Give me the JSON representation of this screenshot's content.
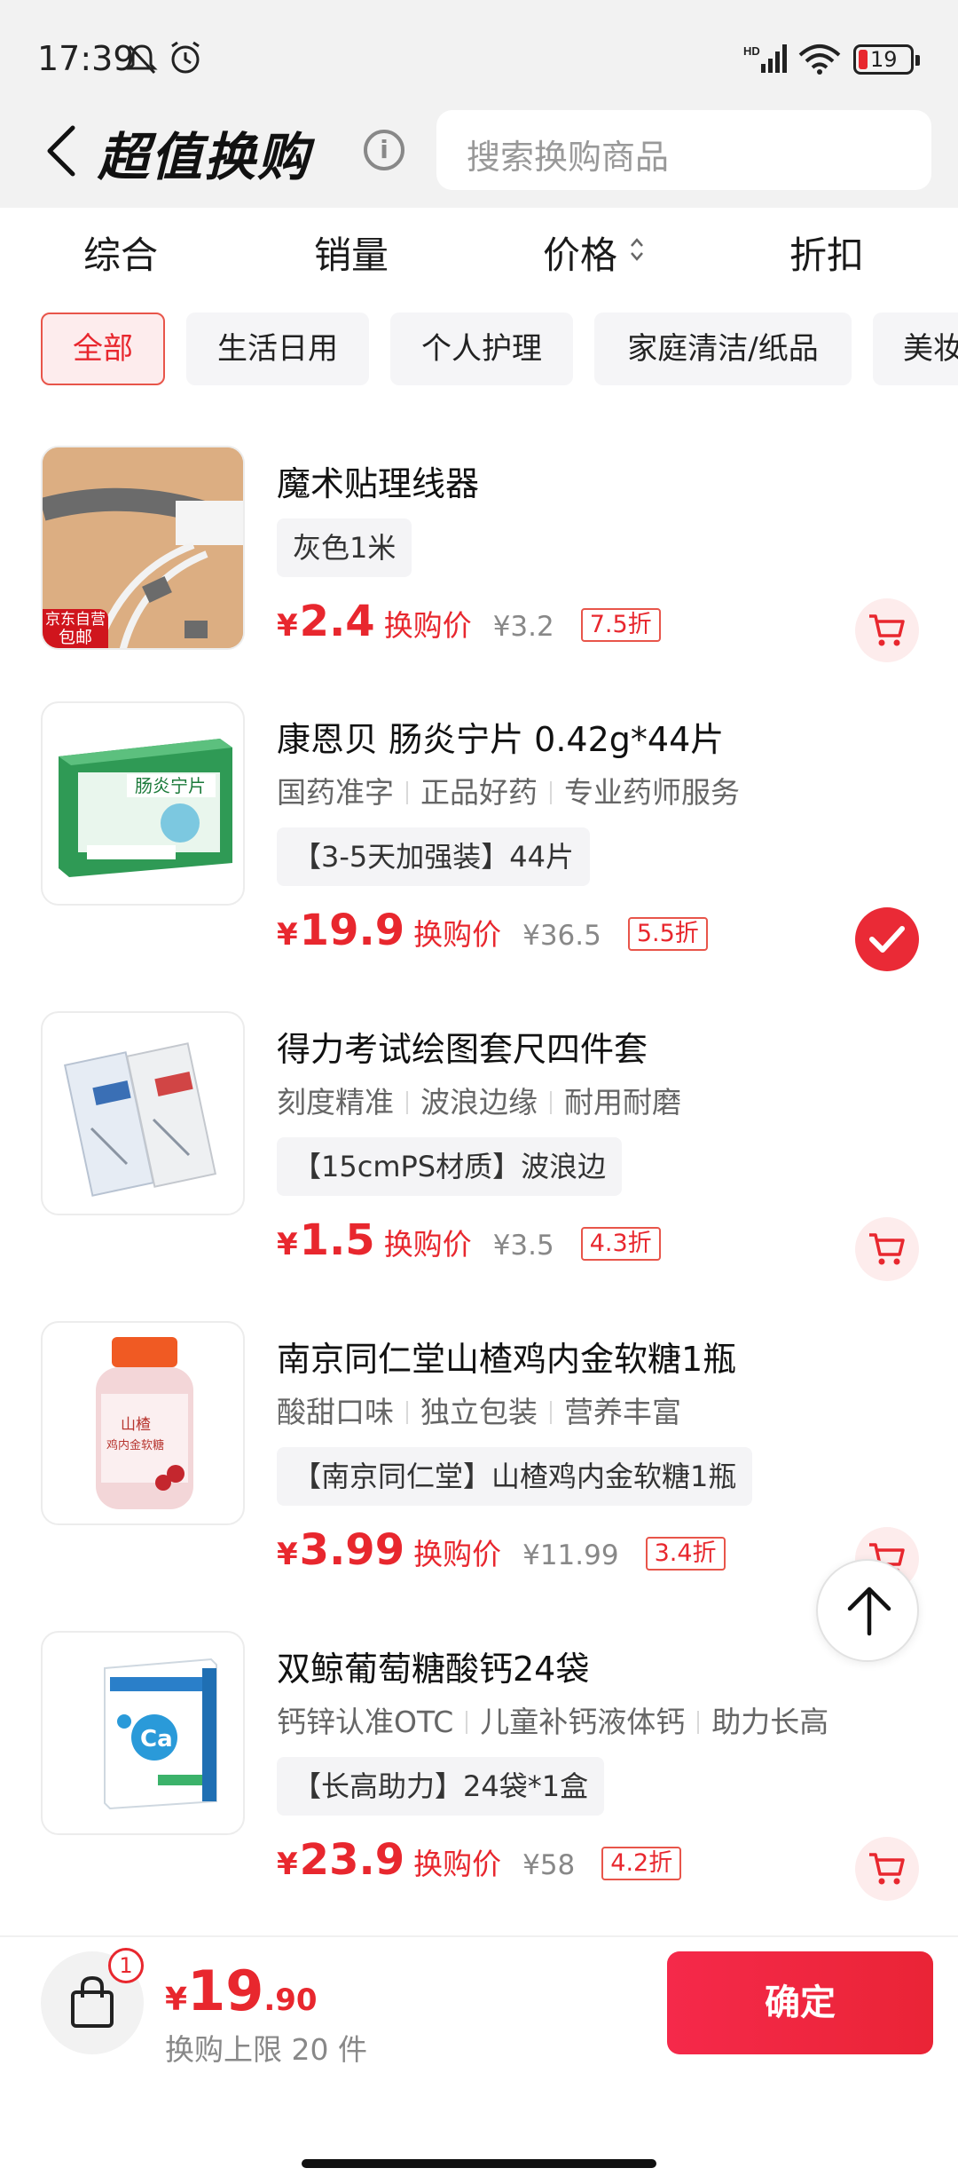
{
  "status_bar": {
    "time": "17:39",
    "battery": "19"
  },
  "header": {
    "title": "超值换购",
    "search_placeholder": "搜索换购商品"
  },
  "sort_tabs": [
    {
      "label": "综合"
    },
    {
      "label": "销量"
    },
    {
      "label": "价格"
    },
    {
      "label": "折扣"
    }
  ],
  "categories": [
    {
      "label": "全部",
      "active": true
    },
    {
      "label": "生活日用"
    },
    {
      "label": "个人护理"
    },
    {
      "label": "家庭清洁/纸品"
    },
    {
      "label": "美妆"
    }
  ],
  "items": [
    {
      "name": "魔术贴理线器",
      "tags": [],
      "spec": "灰色1米",
      "price": "2.4",
      "price_label": "换购价",
      "orig_price": "¥3.2",
      "discount": "7.5折",
      "badge": [
        "京东自营",
        "包邮"
      ],
      "selected": false,
      "icon": "cart-icon"
    },
    {
      "name": "康恩贝 肠炎宁片 0.42g*44片",
      "tags": [
        "国药准字",
        "正品好药",
        "专业药师服务"
      ],
      "spec": "【3-5天加强装】44片",
      "price": "19.9",
      "price_label": "换购价",
      "orig_price": "¥36.5",
      "discount": "5.5折",
      "selected": true,
      "icon": "check-icon"
    },
    {
      "name": "得力考试绘图套尺四件套",
      "tags": [
        "刻度精准",
        "波浪边缘",
        "耐用耐磨"
      ],
      "spec": "【15cmPS材质】波浪边",
      "price": "1.5",
      "price_label": "换购价",
      "orig_price": "¥3.5",
      "discount": "4.3折",
      "selected": false,
      "icon": "cart-icon"
    },
    {
      "name": "南京同仁堂山楂鸡内金软糖1瓶",
      "tags": [
        "酸甜口味",
        "独立包装",
        "营养丰富"
      ],
      "spec": "【南京同仁堂】山楂鸡内金软糖1瓶",
      "price": "3.99",
      "price_label": "换购价",
      "orig_price": "¥11.99",
      "discount": "3.4折",
      "selected": false,
      "icon": "cart-icon"
    },
    {
      "name": "双鲸葡萄糖酸钙24袋",
      "tags": [
        "钙锌认准OTC",
        "儿童补钙液体钙",
        "助力长高"
      ],
      "spec": "【长高助力】24袋*1盒",
      "price": "23.9",
      "price_label": "换购价",
      "orig_price": "¥58",
      "discount": "4.2折",
      "selected": false,
      "icon": "cart-icon"
    }
  ],
  "footer": {
    "bag_count": "1",
    "currency": "¥",
    "total_int": "19",
    "total_dec": ".90",
    "limit_text": "换购上限 20 件",
    "confirm_label": "确定"
  },
  "colors": {
    "accent": "#e8272e",
    "header_bg": "#f2f2f2",
    "chip_bg": "#f5f5f7"
  }
}
